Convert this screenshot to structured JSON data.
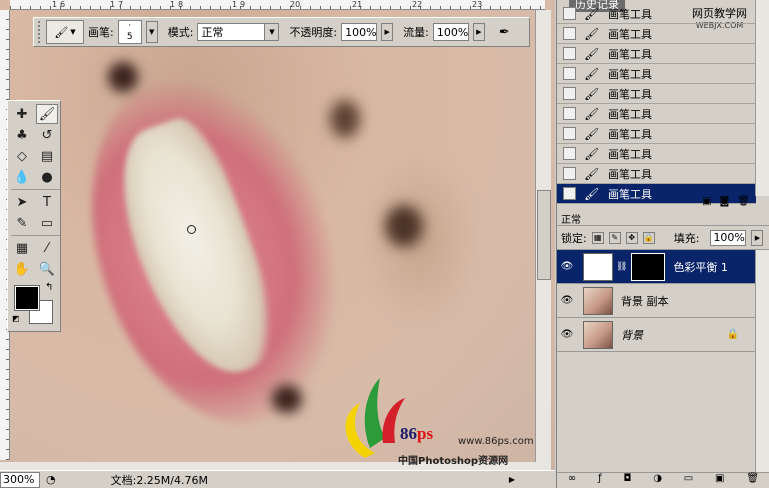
{
  "options_bar": {
    "brush_label": "画笔:",
    "brush_size": "5",
    "mode_label": "模式:",
    "mode_value": "正常",
    "opacity_label": "不透明度:",
    "opacity_value": "100%",
    "flow_label": "流量:",
    "flow_value": "100%"
  },
  "rulers": {
    "top_marks": [
      "1",
      "6",
      "1",
      "7",
      "1",
      "8",
      "1",
      "9",
      "20",
      "21",
      "22",
      "23"
    ]
  },
  "status_bar": {
    "zoom": "300%",
    "doc_info": "文档:2.25M/4.76M"
  },
  "watermark": {
    "brand": "86",
    "brand_suffix": "ps",
    "url": "www.86ps.com",
    "caption": "中国Photoshop资源网"
  },
  "history_panel": {
    "tab_label": "历史记录",
    "site_watermark": "网页教学网",
    "site_url": "WEBJX.COM",
    "items": [
      {
        "label": "画笔工具",
        "selected": false
      },
      {
        "label": "画笔工具",
        "selected": false
      },
      {
        "label": "画笔工具",
        "selected": false
      },
      {
        "label": "画笔工具",
        "selected": false
      },
      {
        "label": "画笔工具",
        "selected": false
      },
      {
        "label": "画笔工具",
        "selected": false
      },
      {
        "label": "画笔工具",
        "selected": false
      },
      {
        "label": "画笔工具",
        "selected": false
      },
      {
        "label": "画笔工具",
        "selected": false
      },
      {
        "label": "画笔工具",
        "selected": true
      }
    ]
  },
  "layers_panel": {
    "blend_mode": "正常",
    "lock_label": "锁定:",
    "fill_label": "填充:",
    "fill_value": "100%",
    "layers": [
      {
        "name": "色彩平衡 1",
        "type": "adjustment",
        "selected": true
      },
      {
        "name": "背景 副本",
        "type": "photo",
        "selected": false
      },
      {
        "name": "背景",
        "type": "photo",
        "selected": false,
        "locked": true
      }
    ]
  },
  "icons": {
    "brush": "brush-icon",
    "eye": "eye-icon",
    "lock": "lock-icon"
  }
}
